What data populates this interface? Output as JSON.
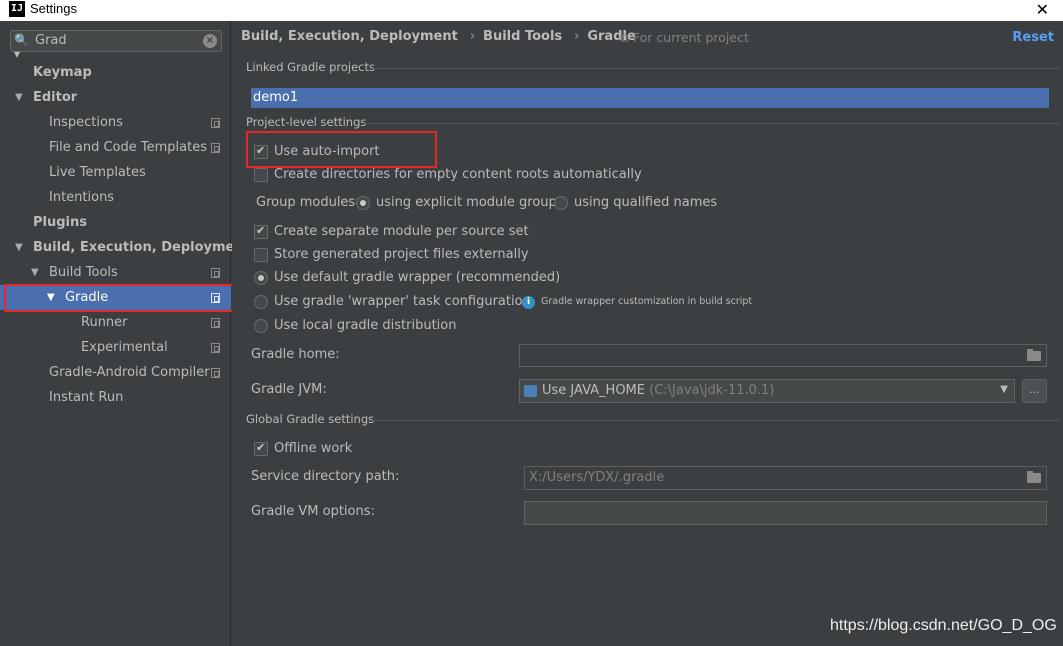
{
  "window": {
    "title": "Settings",
    "app_icon": "IJ"
  },
  "search": {
    "value": "Grad"
  },
  "tree": [
    {
      "label": "Keymap"
    },
    {
      "label": "Editor"
    },
    {
      "label": "Inspections"
    },
    {
      "label": "File and Code Templates"
    },
    {
      "label": "Live Templates"
    },
    {
      "label": "Intentions"
    },
    {
      "label": "Plugins"
    },
    {
      "label": "Build, Execution, Deployment"
    },
    {
      "label": "Build Tools"
    },
    {
      "label": "Gradle"
    },
    {
      "label": "Runner"
    },
    {
      "label": "Experimental"
    },
    {
      "label": "Gradle-Android Compiler"
    },
    {
      "label": "Instant Run"
    }
  ],
  "breadcrumb": {
    "part1": "Build, Execution, Deployment",
    "part2": "Build Tools",
    "part3": "Gradle",
    "separator": "›",
    "scope": "For current project",
    "reset": "Reset"
  },
  "linked": {
    "group_title": "Linked Gradle projects",
    "project": "demo1"
  },
  "project_settings": {
    "group_title": "Project-level settings",
    "auto_import": "Use auto-import",
    "create_dirs": "Create directories for empty content roots automatically",
    "group_modules_label": "Group modules:",
    "group_opt_explicit": "using explicit module groups",
    "group_opt_qualified": "using qualified names",
    "separate_module": "Create separate module per source set",
    "store_external": "Store generated project files externally",
    "wrapper_default": "Use default gradle wrapper (recommended)",
    "wrapper_task": "Use gradle 'wrapper' task configuration",
    "wrapper_hint": "Gradle wrapper customization in build script",
    "local_dist": "Use local gradle distribution",
    "gradle_home_label": "Gradle home:",
    "gradle_home_value": "",
    "gradle_jvm_label": "Gradle JVM:",
    "gradle_jvm_value": "Use JAVA_HOME",
    "gradle_jvm_path": "(C:\\Java\\jdk-11.0.1)",
    "browse": "..."
  },
  "global_settings": {
    "group_title": "Global Gradle settings",
    "offline": "Offline work",
    "service_dir_label": "Service directory path:",
    "service_dir_value": "X:/Users/YDX/.gradle",
    "vm_options_label": "Gradle VM options:",
    "vm_options_value": ""
  },
  "state": {
    "auto_import": true,
    "create_dirs": false,
    "group_modules": "explicit",
    "separate_module": true,
    "store_external": false,
    "wrapper": "default",
    "offline": true
  },
  "watermark": "https://blog.csdn.net/GO_D_OG",
  "colors": {
    "selection": "#4b6eaf",
    "link": "#589df6",
    "highlight_box": "#e8262a",
    "background": "#3c3f41"
  }
}
